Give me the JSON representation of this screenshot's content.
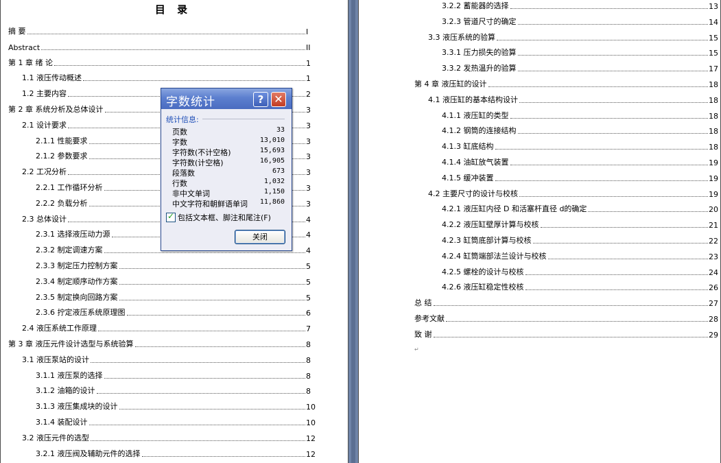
{
  "document": {
    "title": "目 录",
    "left_toc": [
      {
        "text": "摘 要",
        "page": "I",
        "level": 0
      },
      {
        "text": "Abstract",
        "page": "II",
        "level": 0
      },
      {
        "text": "第 1 章 绪 论",
        "page": "1",
        "level": 0
      },
      {
        "text": "1.1 液压传动概述",
        "page": "1",
        "level": 1
      },
      {
        "text": "1.2 主要内容",
        "page": "2",
        "level": 1
      },
      {
        "text": "第 2 章 系统分析及总体设计",
        "page": "3",
        "level": 0
      },
      {
        "text": "2.1 设计要求",
        "page": "3",
        "level": 1
      },
      {
        "text": "2.1.1 性能要求",
        "page": "3",
        "level": 2
      },
      {
        "text": "2.1.2 参数要求",
        "page": "3",
        "level": 2
      },
      {
        "text": "2.2 工况分析",
        "page": "3",
        "level": 1
      },
      {
        "text": "2.2.1 工作循环分析",
        "page": "3",
        "level": 2
      },
      {
        "text": "2.2.2 负载分析",
        "page": "3",
        "level": 2
      },
      {
        "text": "2.3 总体设计",
        "page": "4",
        "level": 1
      },
      {
        "text": "2.3.1 选择液压动力源",
        "page": "4",
        "level": 2
      },
      {
        "text": "2.3.2 制定调速方案",
        "page": "4",
        "level": 2
      },
      {
        "text": "2.3.3 制定压力控制方案",
        "page": "5",
        "level": 2
      },
      {
        "text": "2.3.4 制定顺序动作方案",
        "page": "5",
        "level": 2
      },
      {
        "text": "2.3.5 制定换向回路方案",
        "page": "5",
        "level": 2
      },
      {
        "text": "2.3.6 拧定液压系统原理图",
        "page": "6",
        "level": 2
      },
      {
        "text": "2.4 液压系统工作原理",
        "page": "7",
        "level": 1
      },
      {
        "text": "第 3 章 液压元件设计选型与系统验算",
        "page": "8",
        "level": 0
      },
      {
        "text": "3.1 液压泵站的设计",
        "page": "8",
        "level": 1
      },
      {
        "text": "3.1.1 液压泵的选择",
        "page": "8",
        "level": 2
      },
      {
        "text": "3.1.2 油箱的设计",
        "page": "8",
        "level": 2
      },
      {
        "text": "3.1.3 液压集成块的设计",
        "page": "10",
        "level": 2
      },
      {
        "text": "3.1.4 装配设计",
        "page": "10",
        "level": 2
      },
      {
        "text": "3.2 液压元件的选型",
        "page": "12",
        "level": 1
      },
      {
        "text": "3.2.1 液压阀及辅助元件的选择",
        "page": "12",
        "level": 2
      }
    ],
    "right_toc": [
      {
        "text": "3.2.2 蓄能器的选择",
        "page": "13",
        "level": 2
      },
      {
        "text": "3.2.3 管道尺寸的确定",
        "page": "14",
        "level": 2
      },
      {
        "text": "3.3 液压系统的验算",
        "page": "15",
        "level": 1
      },
      {
        "text": "3.3.1 压力损失的验算",
        "page": "15",
        "level": 2
      },
      {
        "text": "3.3.2 发热温升的验算",
        "page": "17",
        "level": 2
      },
      {
        "text": "第 4 章 液压缸的设计",
        "page": "18",
        "level": 0
      },
      {
        "text": "4.1 液压缸的基本结构设计",
        "page": "18",
        "level": 1
      },
      {
        "text": "4.1.1 液压缸的类型",
        "page": "18",
        "level": 2
      },
      {
        "text": "4.1.2 钢筒的连接结构",
        "page": "18",
        "level": 2
      },
      {
        "text": "4.1.3 缸底结构",
        "page": "18",
        "level": 2
      },
      {
        "text": "4.1.4 油缸放气装置",
        "page": "19",
        "level": 2
      },
      {
        "text": "4.1.5 缓冲装置",
        "page": "19",
        "level": 2
      },
      {
        "text": "4.2 主要尺寸的设计与校核",
        "page": "19",
        "level": 1
      },
      {
        "text": "4.2.1 液压缸内径 D 和活塞杆直径 d的确定",
        "page": "20",
        "level": 2
      },
      {
        "text": "4.2.2 液压缸壁厚计算与校核",
        "page": "21",
        "level": 2
      },
      {
        "text": "4.2.3 缸筒底部计算与校核",
        "page": "22",
        "level": 2
      },
      {
        "text": "4.2.4 缸筒端部法兰设计与校核",
        "page": "23",
        "level": 2
      },
      {
        "text": "4.2.5 螺栓的设计与校核",
        "page": "24",
        "level": 2
      },
      {
        "text": "4.2.6 液压缸稳定性校核",
        "page": "26",
        "level": 2
      },
      {
        "text": "总 结",
        "page": "27",
        "level": 0
      },
      {
        "text": "参考文献",
        "page": "28",
        "level": 0
      },
      {
        "text": "致 谢",
        "page": "29",
        "level": 0
      }
    ]
  },
  "dialog": {
    "title": "字数统计",
    "help_icon": "?",
    "close_icon": "✕",
    "section_label": "统计信息:",
    "stats": [
      {
        "label": "页数",
        "value": "33"
      },
      {
        "label": "字数",
        "value": "13,010"
      },
      {
        "label": "字符数(不计空格)",
        "value": "15,693"
      },
      {
        "label": "字符数(计空格)",
        "value": "16,905"
      },
      {
        "label": "段落数",
        "value": "673"
      },
      {
        "label": "行数",
        "value": "1,032"
      },
      {
        "label": "非中文单词",
        "value": "1,150"
      },
      {
        "label": "中文字符和朝鲜语单词",
        "value": "11,860"
      }
    ],
    "checkbox_label": "包括文本框、脚注和尾注(F)",
    "checkbox_checked": true,
    "close_button": "关闭"
  },
  "colors": {
    "dialog_title_bar": "#5c7fcf",
    "section_label": "#1f4fb8",
    "gutter": "#6f84a8"
  }
}
